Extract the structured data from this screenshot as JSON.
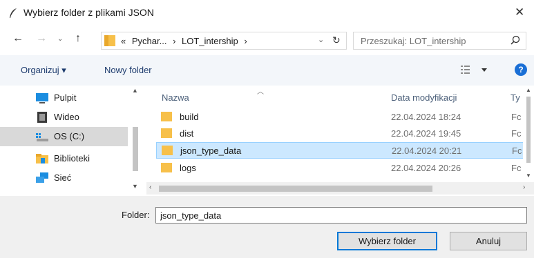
{
  "dialog": {
    "title": "Wybierz folder z plikami JSON",
    "icon": "feather-icon"
  },
  "address": {
    "breadcrumb": [
      "«",
      "Pychar...",
      "›",
      "LOT_intership",
      "›"
    ],
    "search_placeholder": "Przeszukaj: LOT_intership"
  },
  "toolbar": {
    "organize_label": "Organizuj ▾",
    "new_folder_label": "Nowy folder",
    "help_label": "?"
  },
  "nav": {
    "items": [
      {
        "label": "Pulpit",
        "icon": "desktop-icon"
      },
      {
        "label": "Wideo",
        "icon": "video-icon"
      },
      {
        "label": "OS (C:)",
        "icon": "drive-icon",
        "selected": true
      },
      {
        "label": "Biblioteki",
        "icon": "library-icon"
      },
      {
        "label": "Sieć",
        "icon": "network-icon"
      }
    ]
  },
  "files": {
    "columns": {
      "name": "Nazwa",
      "date": "Data modyfikacji",
      "type": "Ty"
    },
    "rows": [
      {
        "name": "build",
        "date": "22.04.2024 18:24",
        "type": "Fc"
      },
      {
        "name": "dist",
        "date": "22.04.2024 19:45",
        "type": "Fc"
      },
      {
        "name": "json_type_data",
        "date": "22.04.2024 20:21",
        "type": "Fc",
        "selected": true
      },
      {
        "name": "logs",
        "date": "22.04.2024 20:26",
        "type": "Fc"
      }
    ]
  },
  "bottom": {
    "folder_label": "Folder:",
    "folder_value": "json_type_data",
    "select_button": "Wybierz folder",
    "cancel_button": "Anuluj"
  },
  "colors": {
    "accent": "#0078d7",
    "selection": "#cce8ff",
    "folder": "#f7c04a"
  }
}
